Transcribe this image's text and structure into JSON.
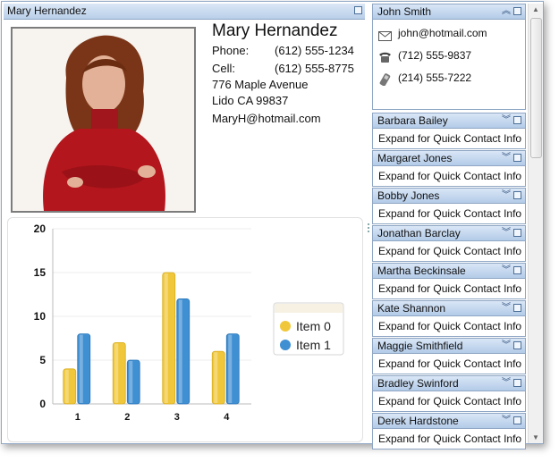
{
  "main_window": {
    "title": "Mary Hernandez"
  },
  "contact": {
    "name": "Mary Hernandez",
    "phone_label": "Phone:",
    "phone": "(612) 555-1234",
    "cell_label": "Cell:",
    "cell": "(612) 555-8775",
    "address1": "776 Maple Avenue",
    "address2": "Lido CA 99837",
    "email": "MaryH@hotmail.com"
  },
  "expanded_card": {
    "name": "John Smith",
    "email": "john@hotmail.com",
    "phone": "(712) 555-9837",
    "cell": "(214) 555-7222"
  },
  "cards": [
    {
      "name": "Barbara Bailey",
      "info": "Expand for Quick Contact Info"
    },
    {
      "name": "Margaret Jones",
      "info": "Expand for Quick Contact Info"
    },
    {
      "name": "Bobby Jones",
      "info": "Expand for Quick Contact Info"
    },
    {
      "name": "Jonathan Barclay",
      "info": "Expand for Quick Contact Info"
    },
    {
      "name": "Martha Beckinsale",
      "info": "Expand for Quick Contact Info"
    },
    {
      "name": "Kate Shannon",
      "info": "Expand for Quick Contact Info"
    },
    {
      "name": "Maggie Smithfield",
      "info": "Expand for Quick Contact Info"
    },
    {
      "name": "Bradley Swinford",
      "info": "Expand for Quick Contact Info"
    },
    {
      "name": "Derek Hardstone",
      "info": "Expand for Quick Contact Info"
    }
  ],
  "icons": {
    "email": "envelope-icon",
    "phone": "telephone-icon",
    "cell": "cell-phone-icon"
  },
  "colors": {
    "series0": "#f0c73a",
    "series1": "#3f8fd3",
    "header": "#c6d8ef"
  },
  "chart_data": {
    "type": "bar",
    "categories": [
      "1",
      "2",
      "3",
      "4"
    ],
    "series": [
      {
        "name": "Item 0",
        "values": [
          4,
          7,
          15,
          6
        ]
      },
      {
        "name": "Item 1",
        "values": [
          8,
          5,
          12,
          8
        ]
      }
    ],
    "ylim": [
      0,
      20
    ],
    "yticks": [
      "0",
      "5",
      "10",
      "15",
      "20"
    ],
    "grid": true,
    "legend_position": "right",
    "title": "",
    "xlabel": "",
    "ylabel": ""
  }
}
